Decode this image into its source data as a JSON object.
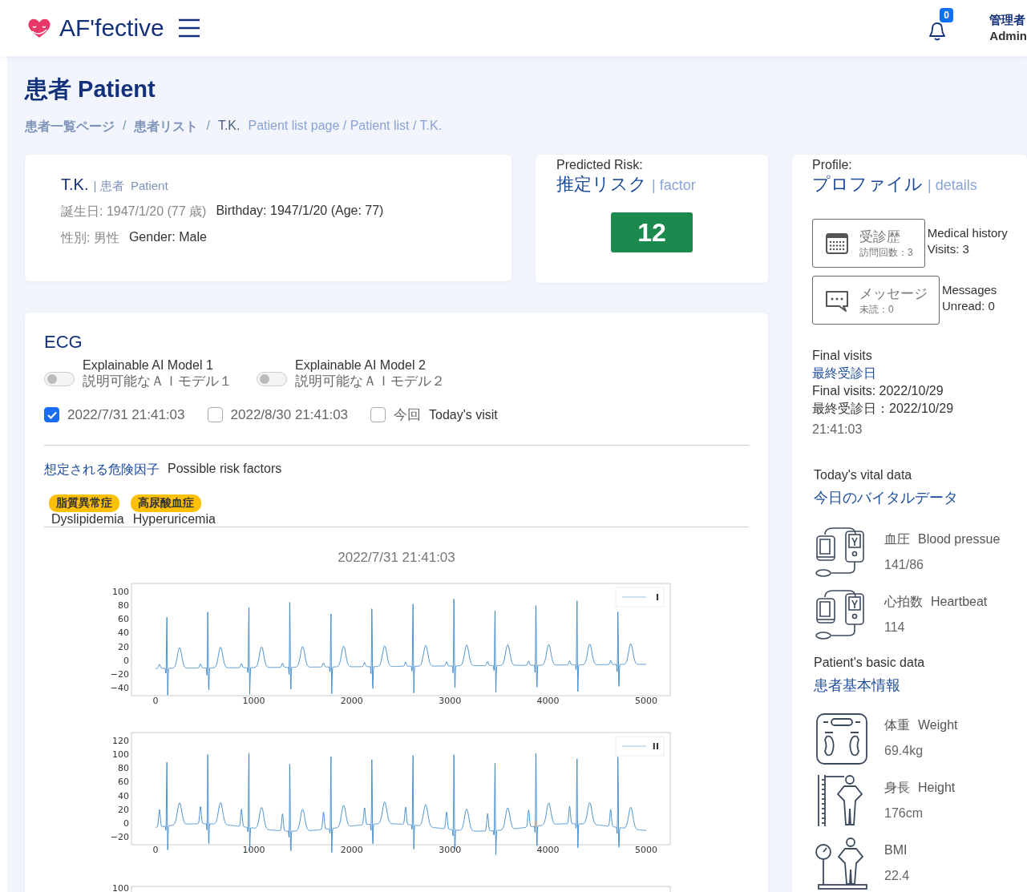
{
  "header": {
    "brand": "AF'fective",
    "notifications": "0",
    "user_ja": "管理者",
    "user_en": "Admin"
  },
  "page_title": "患者 Patient",
  "breadcrumb": {
    "items": [
      "患者一覧ページ",
      "患者リスト",
      "T.K."
    ],
    "separator": "/",
    "english": "Patient list page / Patient list / T.K."
  },
  "patient": {
    "name": "T.K.",
    "role_ja": "| 患者",
    "role_en": "Patient",
    "birthday_ja": "誕生日: 1947/1/20 (77 歳)",
    "birthday_en": "Birthday: 1947/1/20 (Age: 77)",
    "gender_ja": "性別: 男性",
    "gender_en": "Gender: Male"
  },
  "risk": {
    "label": "Predicted Risk:",
    "title": "推定リスク",
    "subtitle": "| factor",
    "score": "12"
  },
  "profile": {
    "label": "Profile:",
    "title": "プロファイル",
    "subtitle": "| details",
    "buttons": [
      {
        "kind": "calendar",
        "title": "受診歴",
        "sub": "訪問回数：3",
        "side": [
          "Medical history",
          "Visits: 3"
        ]
      },
      {
        "kind": "message",
        "title": "メッセージ",
        "sub": "未読：0",
        "side": [
          "Messages",
          "Unread: 0"
        ]
      }
    ],
    "final_visit": {
      "label_en": "Final visits",
      "label_ja": "最終受診日",
      "lines": [
        "Final visits: 2022/10/29",
        "最終受診日：2022/10/29"
      ],
      "time": "21:41:03"
    },
    "vitals": {
      "label_en": "Today's vital data",
      "label_ja": "今日のバイタルデータ",
      "items": [
        {
          "kind": "blood-pressure",
          "name_ja": "血圧",
          "name_en": "Blood pressue",
          "value": "141/86"
        },
        {
          "kind": "blood-pressure",
          "name_ja": "心拍数",
          "name_en": "Heartbeat",
          "value": "114"
        }
      ]
    },
    "basic": {
      "label_en": "Patient's basic data",
      "label_ja": "患者基本情報",
      "items": [
        {
          "kind": "scale",
          "name_ja": "体重",
          "name_en": "Weight",
          "value": "69.4kg"
        },
        {
          "kind": "height",
          "name_ja": "身長",
          "name_en": "Height",
          "value": "176cm"
        },
        {
          "kind": "bmi",
          "name_en": "BMI",
          "value": "22.4"
        }
      ]
    }
  },
  "ecg": {
    "title": "ECG",
    "toggles": [
      {
        "en": "Explainable AI Model 1",
        "ja": "説明可能なＡＩモデル１",
        "on": false
      },
      {
        "en": "Explainable AI Model 2",
        "ja": "説明可能なＡＩモデル２",
        "on": false
      }
    ],
    "visits": [
      {
        "label": "2022/7/31 21:41:03",
        "checked": true
      },
      {
        "label": "2022/8/30 21:41:03",
        "checked": false
      },
      {
        "label": "今回",
        "label_en": "Today's visit",
        "checked": false
      }
    ],
    "risk_factors": {
      "title_ja": "想定される危険因子",
      "title_en": "Possible risk factors",
      "tags": [
        {
          "ja": "脂質異常症",
          "en": "Dyslipidemia"
        },
        {
          "ja": "高尿酸血症",
          "en": "Hyperuricemia"
        }
      ]
    },
    "plot_title": "2022/7/31 21:41:03",
    "plots": [
      {
        "kind": "full",
        "legend": "I",
        "yticks": [
          "100",
          "80",
          "60",
          "40",
          "20",
          "0",
          "−20",
          "−40"
        ],
        "xticks": [
          "0",
          "1000",
          "2000",
          "3000",
          "4000",
          "5000"
        ]
      },
      {
        "kind": "full",
        "legend": "II",
        "yticks": [
          "120",
          "100",
          "80",
          "60",
          "40",
          "20",
          "0",
          "−20"
        ],
        "xticks": [
          "0",
          "1000",
          "2000",
          "3000",
          "4000",
          "5000"
        ]
      },
      {
        "kind": "cut",
        "yticks": [
          "100"
        ]
      }
    ]
  }
}
